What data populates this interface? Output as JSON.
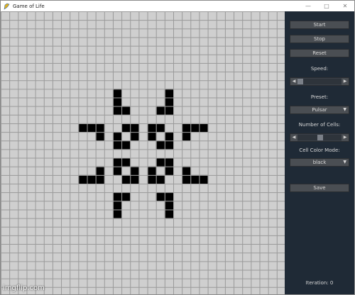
{
  "window": {
    "title": "Game of Life",
    "icon": "feather-icon",
    "controls": {
      "minimize": "—",
      "maximize": "□",
      "close": "✕"
    }
  },
  "grid": {
    "columns": 33,
    "rows": 33,
    "alive_color": "#000000",
    "dead_color": "#cfcfcf",
    "line_color": "#9a9a9a",
    "alive_cells": [
      [
        13,
        9
      ],
      [
        19,
        9
      ],
      [
        13,
        10
      ],
      [
        19,
        10
      ],
      [
        13,
        11
      ],
      [
        14,
        11
      ],
      [
        18,
        11
      ],
      [
        19,
        11
      ],
      [
        9,
        13
      ],
      [
        10,
        13
      ],
      [
        11,
        13
      ],
      [
        14,
        13
      ],
      [
        15,
        13
      ],
      [
        17,
        13
      ],
      [
        18,
        13
      ],
      [
        21,
        13
      ],
      [
        22,
        13
      ],
      [
        23,
        13
      ],
      [
        11,
        14
      ],
      [
        13,
        14
      ],
      [
        15,
        14
      ],
      [
        17,
        14
      ],
      [
        19,
        14
      ],
      [
        21,
        14
      ],
      [
        13,
        15
      ],
      [
        14,
        15
      ],
      [
        18,
        15
      ],
      [
        19,
        15
      ],
      [
        13,
        17
      ],
      [
        14,
        17
      ],
      [
        18,
        17
      ],
      [
        19,
        17
      ],
      [
        11,
        18
      ],
      [
        13,
        18
      ],
      [
        15,
        18
      ],
      [
        17,
        18
      ],
      [
        19,
        18
      ],
      [
        21,
        18
      ],
      [
        9,
        19
      ],
      [
        10,
        19
      ],
      [
        11,
        19
      ],
      [
        14,
        19
      ],
      [
        15,
        19
      ],
      [
        17,
        19
      ],
      [
        18,
        19
      ],
      [
        21,
        19
      ],
      [
        22,
        19
      ],
      [
        23,
        19
      ],
      [
        13,
        21
      ],
      [
        14,
        21
      ],
      [
        18,
        21
      ],
      [
        19,
        21
      ],
      [
        13,
        22
      ],
      [
        19,
        22
      ],
      [
        13,
        23
      ],
      [
        19,
        23
      ]
    ]
  },
  "panel": {
    "background": "#1f2a36",
    "start_label": "Start",
    "stop_label": "Stop",
    "reset_label": "Reset",
    "speed_label": "Speed:",
    "speed_value": 0.0,
    "preset_label": "Preset:",
    "preset_value": "Pulsar",
    "cells_label": "Number of Cells:",
    "cells_value": 0.5,
    "color_mode_label": "Cell Color Mode:",
    "color_mode_value": "black",
    "save_label": "Save",
    "iteration_text": "Iteration: 0"
  },
  "watermark": "imgflip.com"
}
